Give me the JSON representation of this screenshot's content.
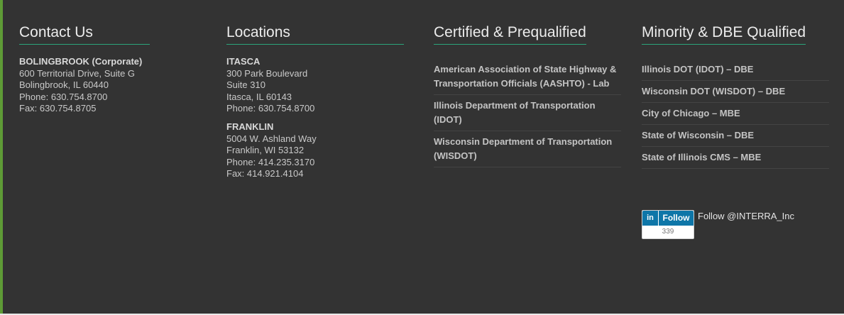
{
  "colors": {
    "background": "#333333",
    "accent_line": "#2ba57a",
    "left_border": "#5e9b36",
    "linkedin_blue": "#0e76a8"
  },
  "contact": {
    "heading": "Contact Us",
    "office": {
      "name": "BOLINGBROOK (Corporate)",
      "lines": [
        "600 Territorial Drive, Suite G",
        "Bolingbrook, IL 60440",
        "Phone: 630.754.8700",
        "Fax: 630.754.8705"
      ]
    }
  },
  "locations": {
    "heading": "Locations",
    "offices": [
      {
        "name": "ITASCA",
        "lines": [
          "300 Park Boulevard",
          "Suite 310",
          "Itasca, IL 60143",
          "Phone: 630.754.8700"
        ]
      },
      {
        "name": "FRANKLIN",
        "lines": [
          "5004 W. Ashland Way",
          "Franklin, WI 53132",
          "Phone: 414.235.3170",
          "Fax: 414.921.4104"
        ]
      }
    ]
  },
  "certified": {
    "heading": "Certified & Prequalified",
    "items": [
      "American Association of State Highway & Transportation Officials (AASHTO) - Lab",
      "Illinois Department of Transportation (IDOT)",
      "Wisconsin Department of Transportation (WISDOT)"
    ]
  },
  "minority": {
    "heading": "Minority & DBE Qualified",
    "items": [
      "Illinois DOT (IDOT) – DBE",
      "Wisconsin DOT (WISDOT) – DBE",
      "City of Chicago – MBE",
      "State of Wisconsin – DBE",
      "State of Illinois CMS – MBE"
    ]
  },
  "social": {
    "linkedin_icon": "in",
    "follow_label": "Follow",
    "follower_count": "339",
    "follow_text": "Follow @INTERRA_Inc"
  }
}
